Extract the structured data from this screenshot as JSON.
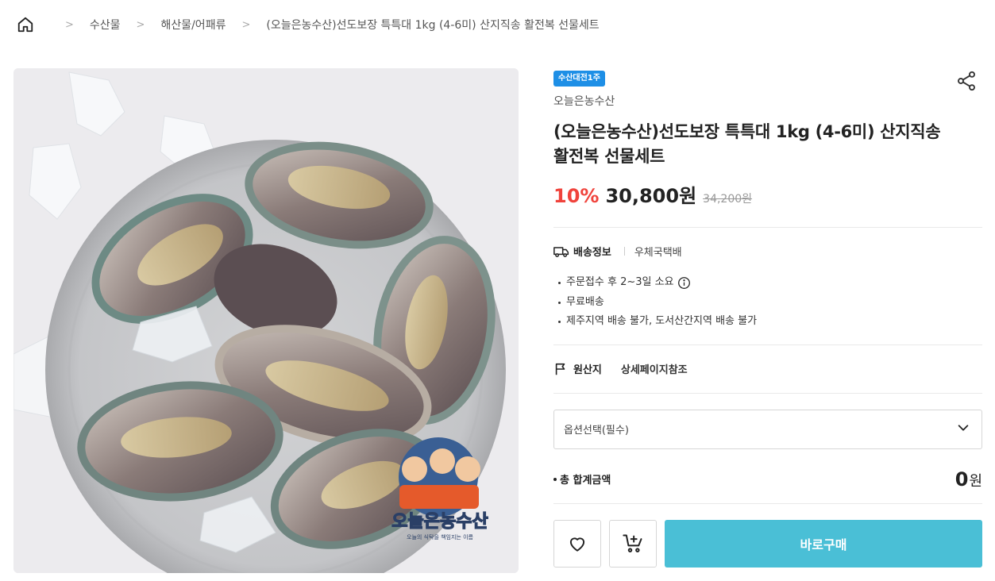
{
  "breadcrumb": {
    "items": [
      "수산물",
      "해산물/어패류",
      "(오늘은농수산)선도보장 특특대 1kg (4-6미) 산지직송 활전복 선물세트"
    ]
  },
  "product": {
    "badge": "수산대전1주",
    "seller": "오늘은농수산",
    "title": "(오늘은농수산)선도보장 특특대 1kg (4-6미) 산지직송 활전복 선물세트",
    "discount": "10%",
    "price": "30,800원",
    "original_price": "34,200원",
    "image_logo": {
      "name": "오늘은농수산",
      "tagline": "오늘의 식탁을 책임지는 이름"
    }
  },
  "shipping": {
    "label": "배송정보",
    "carrier": "우체국택배",
    "notes": [
      "주문접수 후 2~3일 소요",
      "무료배송",
      "제주지역 배송 불가, 도서산간지역 배송 불가"
    ]
  },
  "origin": {
    "label": "원산지",
    "value": "상세페이지참조"
  },
  "option_select": {
    "placeholder": "옵션선택(필수)"
  },
  "total": {
    "label": "총 합계금액",
    "amount": "0",
    "unit": "원"
  },
  "actions": {
    "buy_label": "바로구매"
  },
  "colors": {
    "badge": "#1e8fe6",
    "discount": "#f0433c",
    "buy_button": "#4abfd6"
  },
  "icons": [
    "home-icon",
    "chevron-right-icon",
    "share-icon",
    "truck-icon",
    "info-icon",
    "flag-icon",
    "chevron-down-icon",
    "heart-icon",
    "cart-add-icon"
  ]
}
